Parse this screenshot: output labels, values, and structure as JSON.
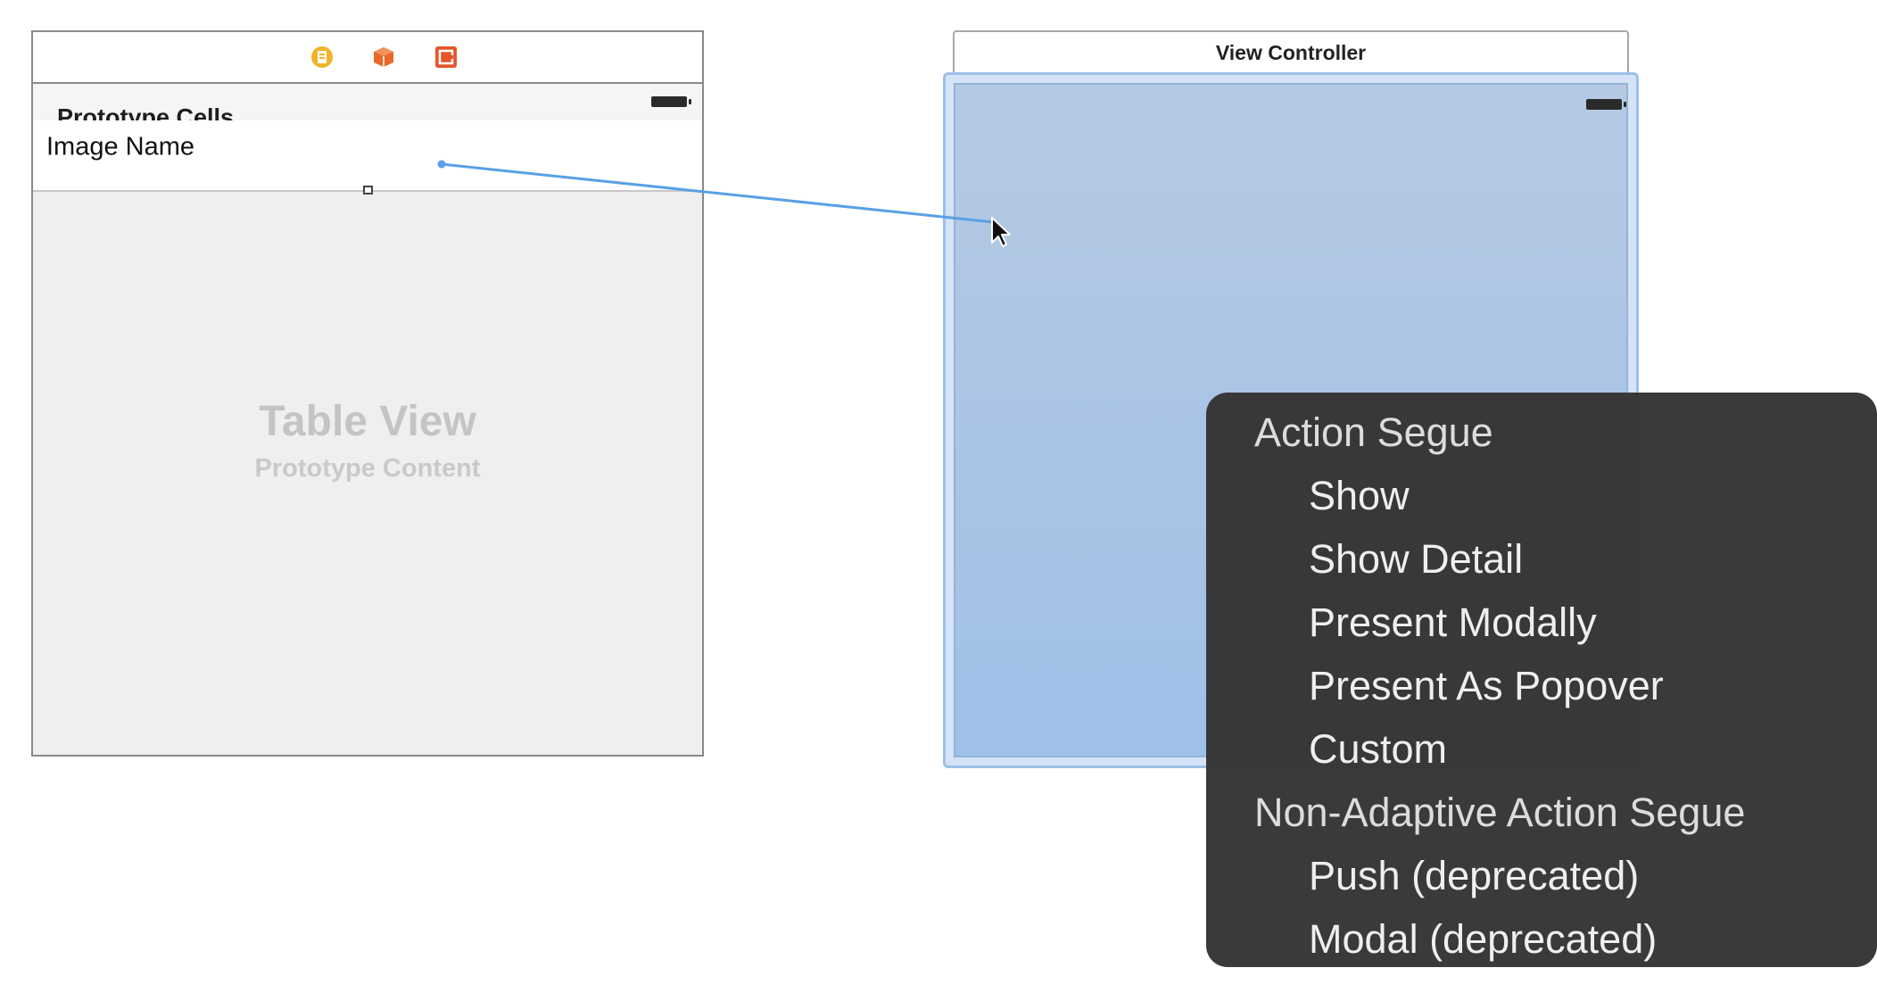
{
  "table_scene": {
    "dock_icons": [
      {
        "name": "view-controller-icon",
        "color": "#f0b428"
      },
      {
        "name": "first-responder-icon",
        "color": "#e8672a"
      },
      {
        "name": "exit-icon",
        "color": "#e6562a"
      }
    ],
    "prototype_cells_header": "Prototype Cells",
    "cell_label": "Image Name",
    "placeholder_title": "Table View",
    "placeholder_subtitle": "Prototype Content"
  },
  "view_controller_scene": {
    "title": "View Controller"
  },
  "segue_menu": {
    "items": [
      {
        "type": "section",
        "label": "Action Segue"
      },
      {
        "type": "option",
        "label": "Show"
      },
      {
        "type": "option",
        "label": "Show Detail"
      },
      {
        "type": "option",
        "label": "Present Modally"
      },
      {
        "type": "option",
        "label": "Present As Popover"
      },
      {
        "type": "option",
        "label": "Custom"
      },
      {
        "type": "section",
        "label": "Non-Adaptive Action Segue"
      },
      {
        "type": "option",
        "label": "Push (deprecated)"
      },
      {
        "type": "option",
        "label": "Modal (deprecated)"
      }
    ]
  },
  "colors": {
    "connection_line": "#5aa0e6",
    "menu_background": "#343434",
    "view_gradient_top": "#b6c9e3",
    "view_gradient_bottom": "#9fc0e8"
  }
}
